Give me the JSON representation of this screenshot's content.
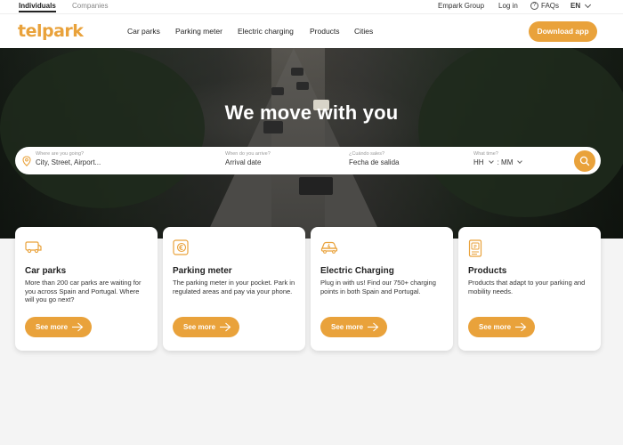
{
  "utility": {
    "individuals": "Individuals",
    "companies": "Companies",
    "empark": "Empark Group",
    "login": "Log in",
    "faqs": "FAQs",
    "faq_symbol": "?",
    "lang": "EN"
  },
  "nav": {
    "logo": "telpark",
    "links": [
      "Car parks",
      "Parking meter",
      "Electric charging",
      "Products",
      "Cities"
    ],
    "download": "Download app"
  },
  "hero": {
    "title": "We move with you"
  },
  "search": {
    "where_label": "Where are you going?",
    "where_value": "City, Street, Airport...",
    "arrive_label": "When do you arrive?",
    "arrive_value": "Arrival date",
    "leave_label": "¿Cuándo sales?",
    "leave_value": "Fecha de salida",
    "time_label": "What time?",
    "hh": "HH",
    "sep": ":",
    "mm": "MM"
  },
  "cards": [
    {
      "title": "Car parks",
      "desc": "More than 200 car parks are waiting for you across Spain and Portugal. Where will you go next?",
      "button": "See more",
      "icon": "car-parks-icon"
    },
    {
      "title": "Parking meter",
      "desc": "The parking meter in your pocket. Park in regulated areas and pay via your phone.",
      "button": "See more",
      "icon": "parking-meter-icon"
    },
    {
      "title": "Electric Charging",
      "desc": "Plug in with us! Find our 750+ charging points in both Spain and Portugal.",
      "button": "See more",
      "icon": "electric-car-icon"
    },
    {
      "title": "Products",
      "desc": "Products that adapt to your parking and mobility needs.",
      "button": "See more",
      "icon": "products-icon"
    }
  ],
  "colors": {
    "accent": "#e9a23b"
  }
}
